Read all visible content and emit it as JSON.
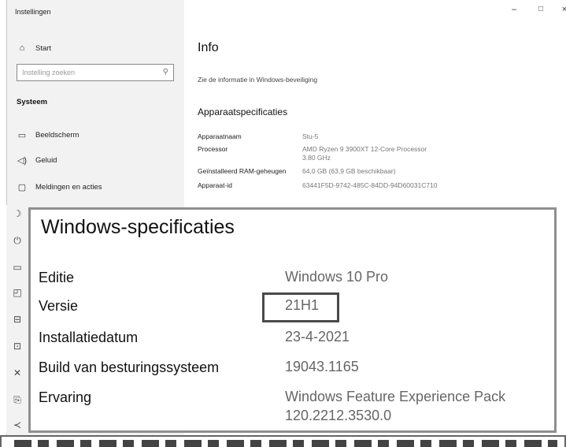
{
  "window": {
    "title": "Instellingen",
    "controls": {
      "minimize": "–",
      "maximize": "□",
      "close": "×"
    }
  },
  "sidebar": {
    "home_label": "Start",
    "search_placeholder": "Instelling zoeken",
    "group_title": "Systeem",
    "items": [
      {
        "label": "Beeldscherm",
        "icon": "monitor-icon"
      },
      {
        "label": "Geluid",
        "icon": "speaker-icon"
      },
      {
        "label": "Meldingen en acties",
        "icon": "notification-icon"
      }
    ]
  },
  "main": {
    "heading": "Info",
    "security_link": "Zie de informatie in Windows-beveiliging",
    "device_specs_heading": "Apparaatspecificaties",
    "device_specs": [
      {
        "label": "Apparaatnaam",
        "value": "Stu-5"
      },
      {
        "label": "Processor",
        "value": "AMD Ryzen 9 3900XT 12-Core Processor 3.80 GHz"
      },
      {
        "label": "Geïnstalleerd RAM-geheugen",
        "value": "64,0 GB (63,9 GB beschikbaar)"
      },
      {
        "label": "Apparaat-id",
        "value": "63441F5D-9742-485C-84DD-94D60031C710"
      }
    ]
  },
  "windows_specs": {
    "heading": "Windows-specificaties",
    "rows": [
      {
        "label": "Editie",
        "value": "Windows 10 Pro"
      },
      {
        "label": "Versie",
        "value": "21H1"
      },
      {
        "label": "Installatiedatum",
        "value": "23-4-2021"
      },
      {
        "label": "Build van besturingssysteem",
        "value": "19043.1165"
      },
      {
        "label": "Ervaring",
        "value": "Windows Feature Experience Pack 120.2212.3530.0"
      }
    ]
  },
  "colors": {
    "sidebar_bg": "#f2f2f2",
    "highlight_border": "#4a4a4a",
    "panel_border": "#8f8f8f"
  }
}
